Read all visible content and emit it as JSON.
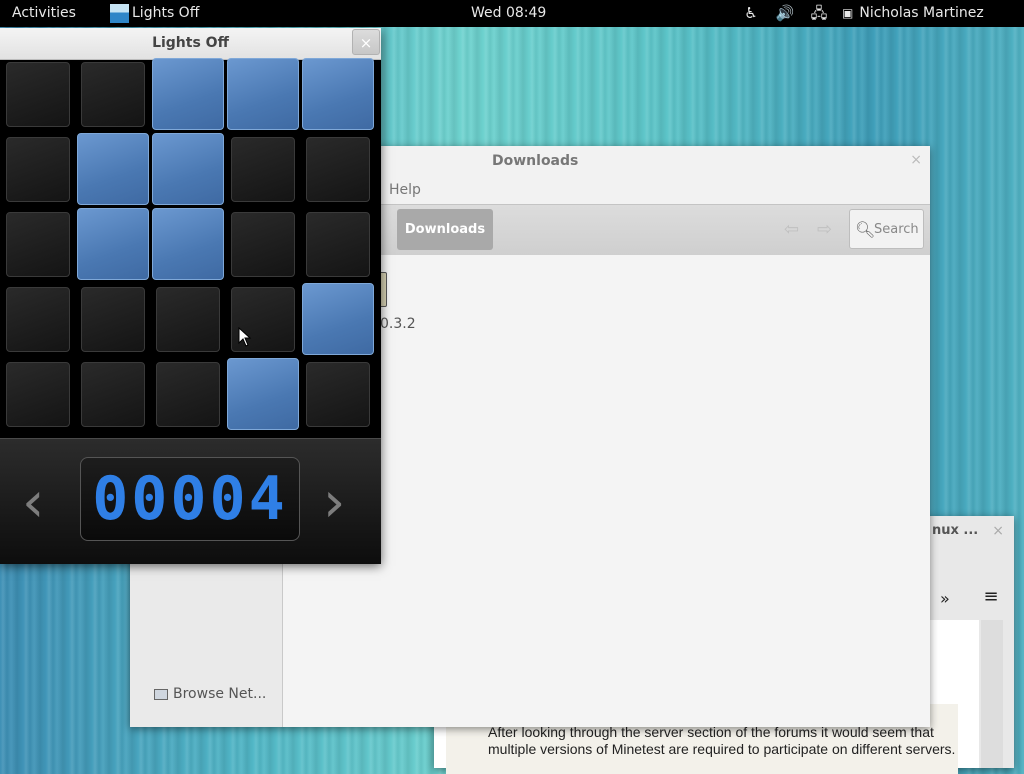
{
  "topbar": {
    "activities": "Activities",
    "app_menu": "Lights Off",
    "clock": "Wed 08:49",
    "tray": [
      {
        "name": "accessibility-icon",
        "glyph": "♿"
      },
      {
        "name": "volume-icon",
        "glyph": "🔊"
      },
      {
        "name": "network-icon",
        "glyph": "🖧"
      }
    ],
    "user": "Nicholas Martinez"
  },
  "lights_off": {
    "title": "Lights Off",
    "close_glyph": "×",
    "board": [
      [
        0,
        0,
        1,
        1,
        1
      ],
      [
        0,
        1,
        1,
        0,
        0
      ],
      [
        0,
        1,
        1,
        0,
        0
      ],
      [
        0,
        0,
        0,
        0,
        1
      ],
      [
        0,
        0,
        0,
        1,
        0
      ]
    ],
    "level_display": "00004",
    "prev_glyph": "‹",
    "next_glyph": "›"
  },
  "files": {
    "title": "Downloads",
    "menu_help": "Help",
    "path_button": "Downloads",
    "search_label": "Search",
    "sidebar_item": "Browse Net...",
    "file_label": "0.3.2",
    "close_glyph": "×"
  },
  "browser": {
    "title": "nux ...",
    "close_glyph": "×",
    "more_glyph": "»",
    "menu_glyph": "≡",
    "post_text": "After looking through the server section of the forums it would seem that multiple versions of Minetest are required to participate on different servers."
  },
  "colors": {
    "light_on": "#5a87c0",
    "light_off": "#1c1c1c",
    "lcd_digit": "#2f7fe6"
  }
}
